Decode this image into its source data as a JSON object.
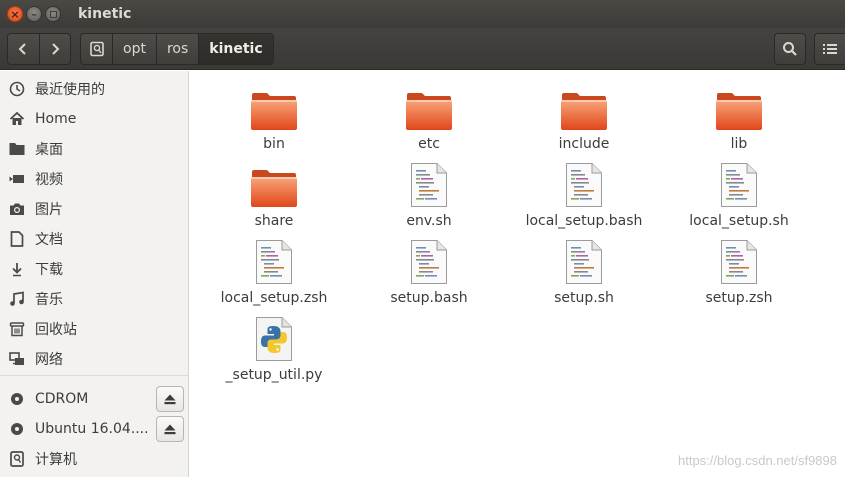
{
  "window": {
    "title": "kinetic"
  },
  "toolbar": {
    "back_icon": "chevron-left-icon",
    "forward_icon": "chevron-right-icon",
    "breadcrumbs": [
      "opt",
      "ros",
      "kinetic"
    ],
    "search_icon": "search-icon",
    "view_icon": "list-view-icon"
  },
  "sidebar": {
    "places": [
      {
        "label": "最近使用的",
        "icon": "clock-icon"
      },
      {
        "label": "Home",
        "icon": "home-icon"
      },
      {
        "label": "桌面",
        "icon": "folder-icon"
      },
      {
        "label": "视频",
        "icon": "video-icon"
      },
      {
        "label": "图片",
        "icon": "camera-icon"
      },
      {
        "label": "文档",
        "icon": "document-icon"
      },
      {
        "label": "下载",
        "icon": "download-icon"
      },
      {
        "label": "音乐",
        "icon": "music-icon"
      },
      {
        "label": "回收站",
        "icon": "trash-icon"
      },
      {
        "label": "网络",
        "icon": "network-icon"
      }
    ],
    "devices": [
      {
        "label": "CDROM",
        "icon": "disc-icon",
        "eject": true
      },
      {
        "label": "Ubuntu 16.04....",
        "icon": "disc-icon",
        "eject": true
      },
      {
        "label": "计算机",
        "icon": "computer-icon",
        "eject": false
      }
    ]
  },
  "files": [
    {
      "name": "bin",
      "type": "folder"
    },
    {
      "name": "etc",
      "type": "folder"
    },
    {
      "name": "include",
      "type": "folder"
    },
    {
      "name": "lib",
      "type": "folder"
    },
    {
      "name": "share",
      "type": "folder"
    },
    {
      "name": "env.sh",
      "type": "script"
    },
    {
      "name": "local_setup.bash",
      "type": "script"
    },
    {
      "name": "local_setup.sh",
      "type": "script"
    },
    {
      "name": "local_setup.zsh",
      "type": "script"
    },
    {
      "name": "setup.bash",
      "type": "script"
    },
    {
      "name": "setup.sh",
      "type": "script"
    },
    {
      "name": "setup.zsh",
      "type": "script"
    },
    {
      "name": "_setup_util.py",
      "type": "python"
    }
  ],
  "watermark": "https://blog.csdn.net/sf9898",
  "colors": {
    "folder": "#e95420",
    "titlebar": "#3c3b37",
    "sidebar": "#f3f2f1"
  }
}
